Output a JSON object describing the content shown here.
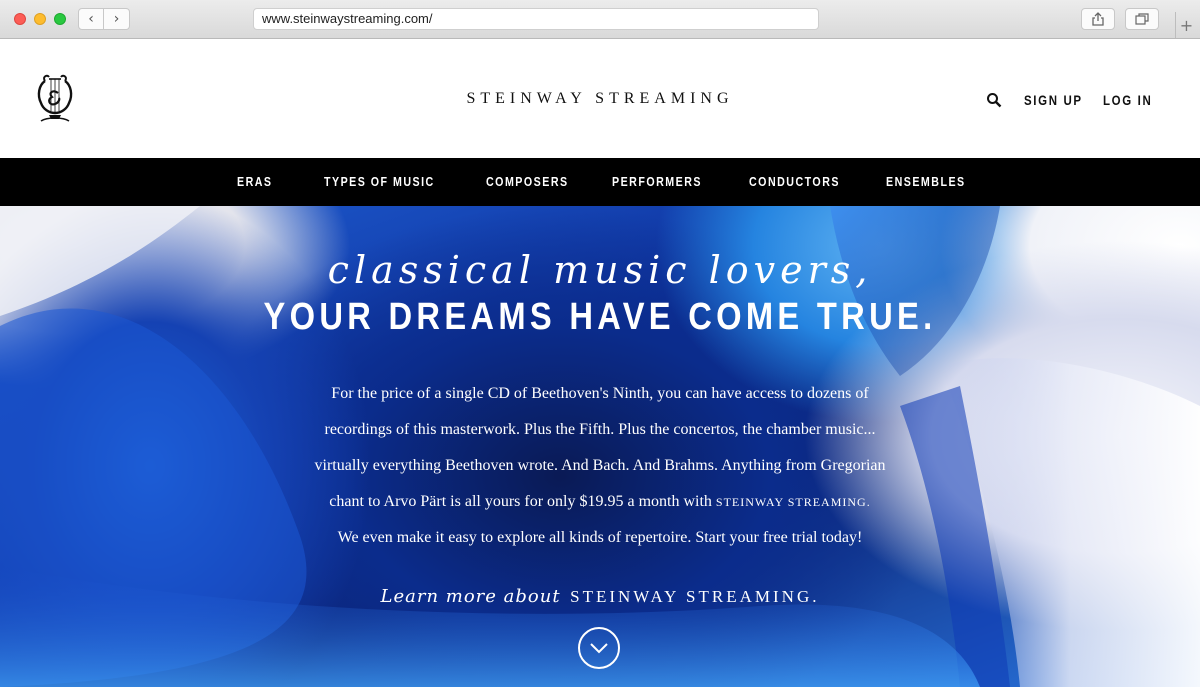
{
  "browser": {
    "url": "www.steinwaystreaming.com/",
    "back_icon": "chevron-left-icon",
    "forward_icon": "chevron-right-icon",
    "share_icon": "share-icon",
    "tabs_icon": "tabs-icon",
    "newtab_label": "+"
  },
  "header": {
    "logo_icon": "lyre-logo-icon",
    "brand": "STEINWAY STREAMING",
    "search_icon": "search-icon",
    "signup_label": "SIGN UP",
    "login_label": "LOG IN"
  },
  "nav": {
    "items": [
      {
        "label": "ERAS"
      },
      {
        "label": "TYPES OF MUSIC"
      },
      {
        "label": "COMPOSERS"
      },
      {
        "label": "PERFORMERS"
      },
      {
        "label": "CONDUCTORS"
      },
      {
        "label": "ENSEMBLES"
      }
    ]
  },
  "hero": {
    "title_line1": "classical music lovers,",
    "title_line2": "YOUR DREAMS HAVE COME TRUE.",
    "body_lines": [
      "For the price of a single CD of Beethoven's Ninth, you can have access to dozens of",
      "recordings of this masterwork. Plus the Fifth. Plus the concertos, the chamber music...",
      "virtually everything Beethoven wrote. And Bach. And Brahms. Anything from Gregorian"
    ],
    "body_line4_prefix": "chant to Arvo Pärt is all yours for only $19.95 a month with ",
    "body_line4_brand": "STEINWAY STREAMING.",
    "body_line5": "We even make it easy to explore all kinds of repertoire. Start your free trial today!",
    "learn_more_prefix": "Learn more about",
    "learn_more_brand": "STEINWAY STREAMING.",
    "scroll_icon": "chevron-down-circle-icon"
  },
  "colors": {
    "nav_bg": "#000000",
    "hero_blue": "#1542b3",
    "text_on_hero": "#ffffff"
  }
}
